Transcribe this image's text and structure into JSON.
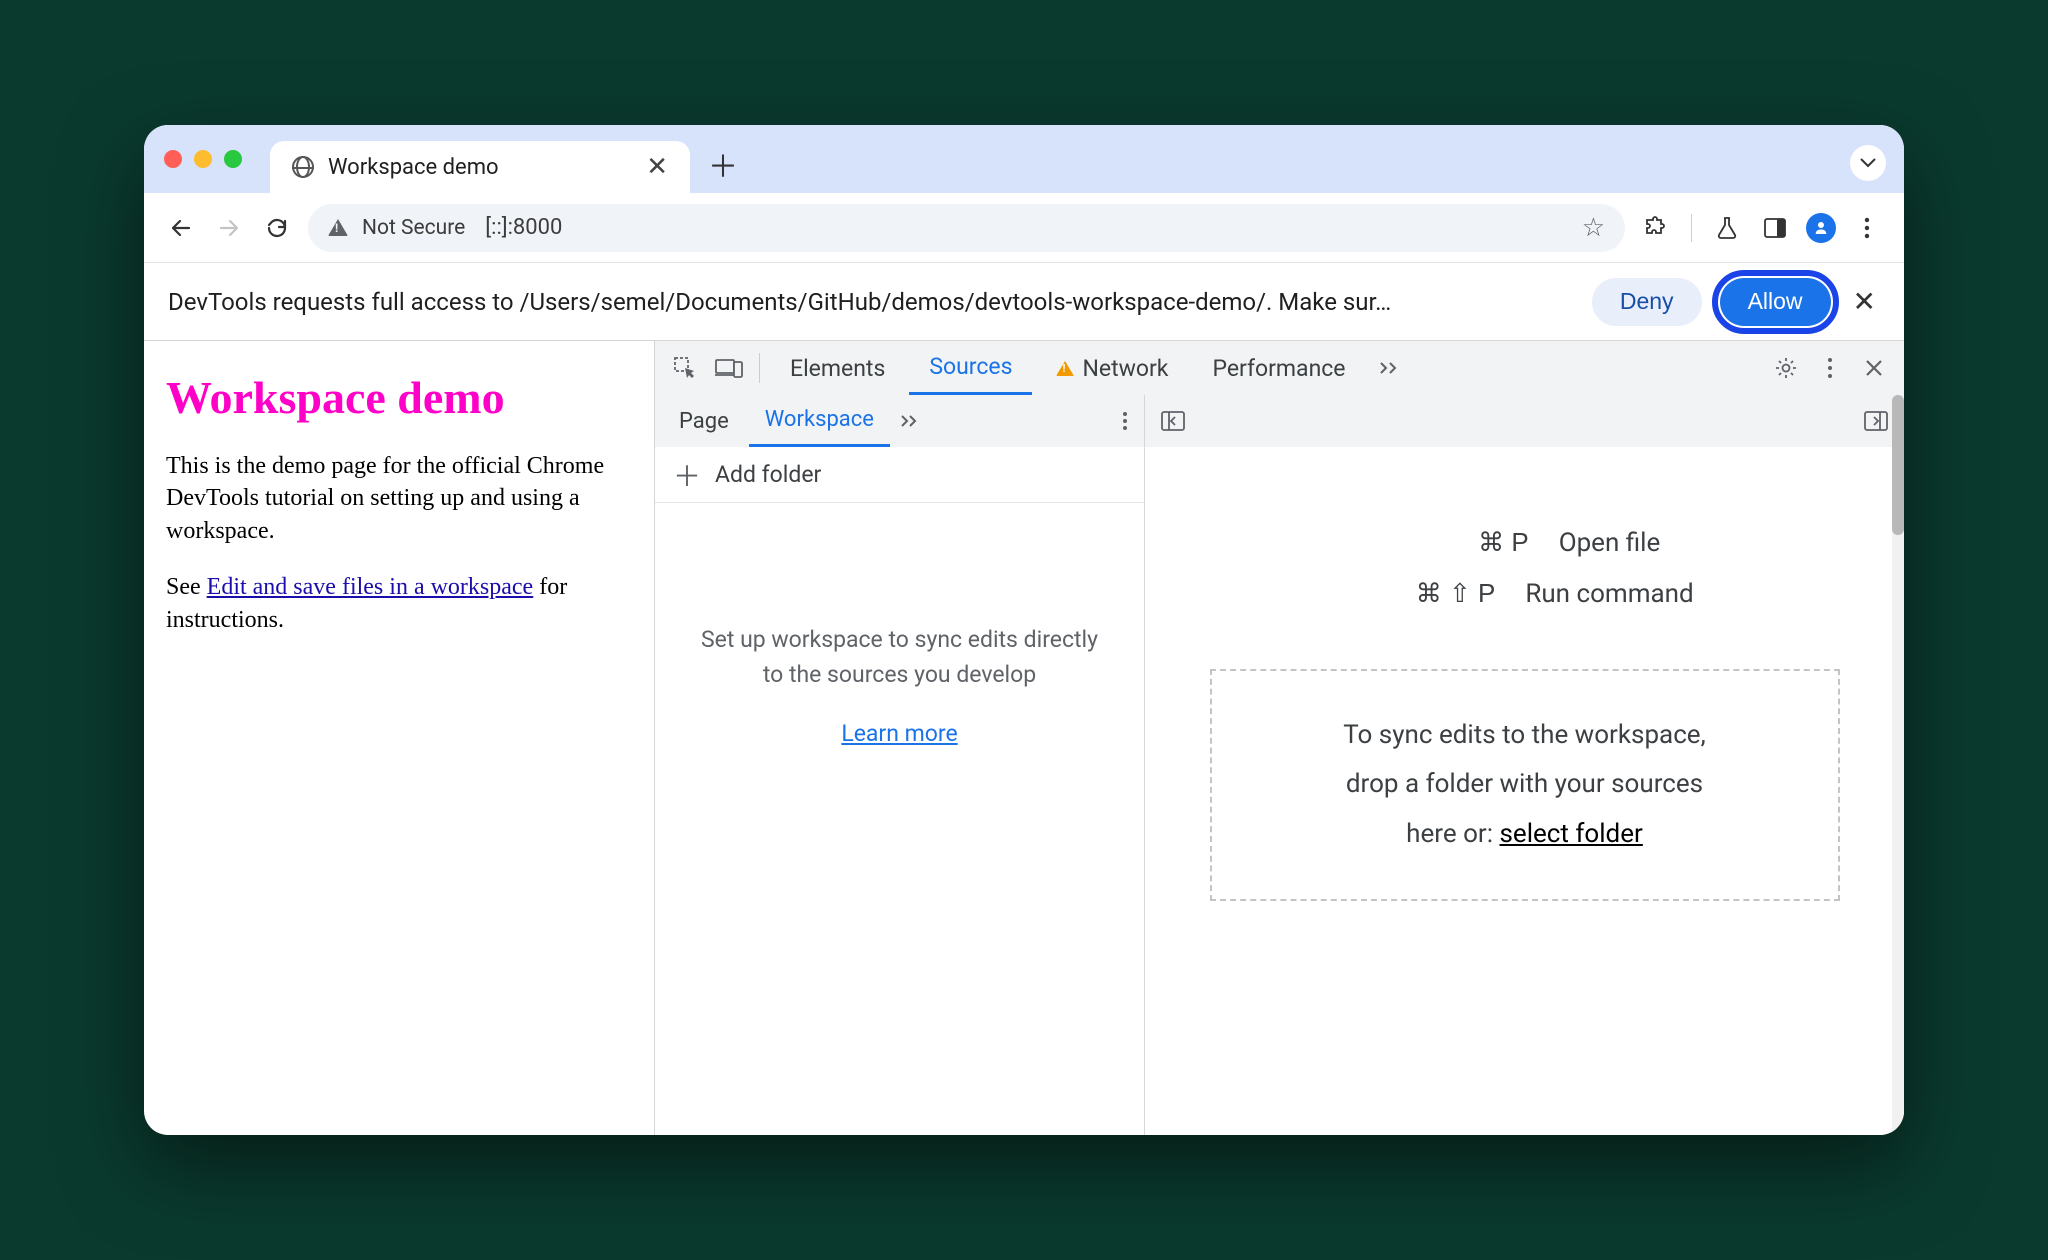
{
  "browser": {
    "tab_title": "Workspace demo",
    "omnibox": {
      "security_label": "Not Secure",
      "url": "[::]:8000"
    }
  },
  "permission": {
    "message": "DevTools requests full access to /Users/semel/Documents/GitHub/demos/devtools-workspace-demo/. Make sur…",
    "deny": "Deny",
    "allow": "Allow"
  },
  "page": {
    "heading": "Workspace demo",
    "p1": "This is the demo page for the official Chrome DevTools tutorial on setting up and using a workspace.",
    "p2_prefix": "See ",
    "p2_link": "Edit and save files in a workspace",
    "p2_suffix": " for instructions."
  },
  "devtools": {
    "tabs": {
      "elements": "Elements",
      "sources": "Sources",
      "network": "Network",
      "performance": "Performance"
    },
    "sources": {
      "nav_tabs": {
        "page": "Page",
        "workspace": "Workspace"
      },
      "add_folder": "Add folder",
      "help_text": "Set up workspace to sync edits directly to the sources you develop",
      "learn_more": "Learn more",
      "shortcuts": {
        "open_keys": "⌘ P",
        "open_label": "Open file",
        "run_keys": "⌘ ⇧ P",
        "run_label": "Run command"
      },
      "drop_text_1": "To sync edits to the workspace,",
      "drop_text_2": "drop a folder with your sources",
      "drop_text_3a": "here or: ",
      "drop_text_3b": "select folder"
    }
  }
}
